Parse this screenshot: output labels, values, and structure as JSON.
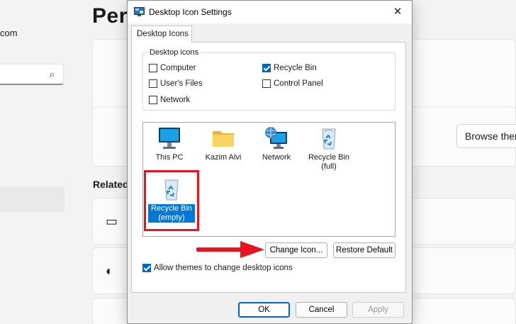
{
  "background": {
    "title": "Pers",
    "account_fragment": "com",
    "browse_button": "Browse then",
    "related_heading": "Related"
  },
  "dialog": {
    "title": "Desktop Icon Settings",
    "tab_label": "Desktop Icons",
    "group_label": "Desktop icons",
    "checkboxes": [
      {
        "label": "Computer",
        "checked": false
      },
      {
        "label": "Recycle Bin",
        "checked": true
      },
      {
        "label": "User's Files",
        "checked": false
      },
      {
        "label": "Control Panel",
        "checked": false
      },
      {
        "label": "Network",
        "checked": false
      }
    ],
    "icons": [
      {
        "label": "This PC"
      },
      {
        "label": "Kazim Alvi"
      },
      {
        "label": "Network"
      },
      {
        "label": "Recycle Bin (full)"
      },
      {
        "label": "Recycle Bin (empty)",
        "selected": true
      }
    ],
    "change_icon_button": "Change Icon...",
    "restore_default_button": "Restore Default",
    "allow_themes_label": "Allow themes to change desktop icons",
    "allow_themes_checked": true,
    "ok_button": "OK",
    "cancel_button": "Cancel",
    "apply_button": "Apply"
  },
  "colors": {
    "accent": "#0067c0",
    "annotation_red": "#e8131f"
  }
}
